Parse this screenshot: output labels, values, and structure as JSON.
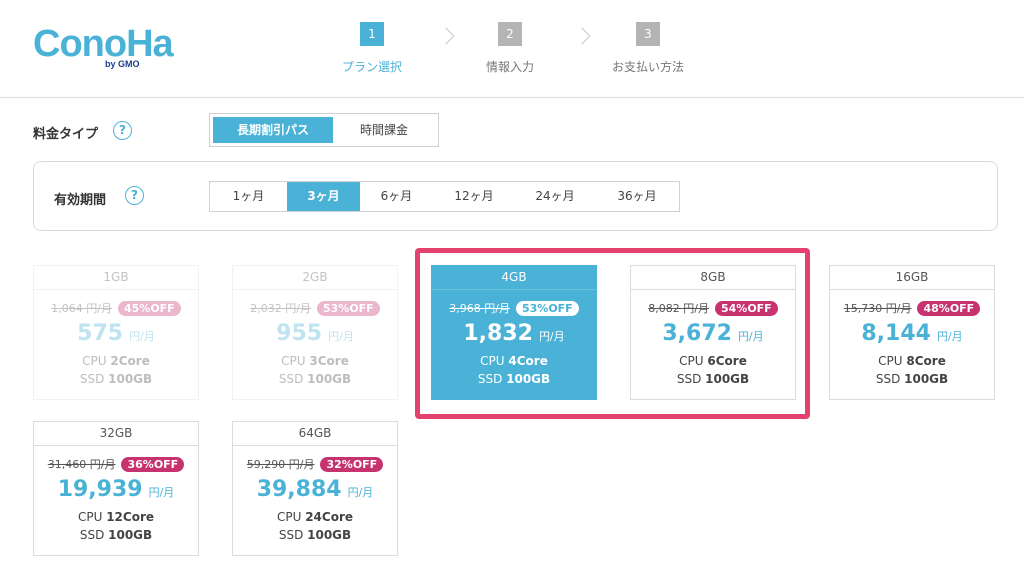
{
  "logo": {
    "text": "ConoHa",
    "by": "by GMO"
  },
  "steps": [
    {
      "num": "1",
      "label": "プラン選択"
    },
    {
      "num": "2",
      "label": "情報入力"
    },
    {
      "num": "3",
      "label": "お支払い方法"
    }
  ],
  "pricing_type": {
    "label": "料金タイプ",
    "options": [
      "長期割引パス",
      "時間課金"
    ],
    "selected": "長期割引パス"
  },
  "period": {
    "label": "有効期間",
    "options": [
      "1ヶ月",
      "3ヶ月",
      "6ヶ月",
      "12ヶ月",
      "24ヶ月",
      "36ヶ月"
    ],
    "selected": "3ヶ月"
  },
  "help_glyph": "?",
  "plans": [
    {
      "name": "1GB",
      "original": "1,064 円/月",
      "discount": "45%OFF",
      "price": "575",
      "unit": "円/月",
      "cpu_label": "CPU ",
      "cpu": "2Core",
      "ssd_label": "SSD ",
      "ssd": "100GB",
      "state": "disabled"
    },
    {
      "name": "2GB",
      "original": "2,032 円/月",
      "discount": "53%OFF",
      "price": "955",
      "unit": "円/月",
      "cpu_label": "CPU ",
      "cpu": "3Core",
      "ssd_label": "SSD ",
      "ssd": "100GB",
      "state": "disabled"
    },
    {
      "name": "4GB",
      "original": "3,968 円/月",
      "discount": "53%OFF",
      "price": "1,832",
      "unit": "円/月",
      "cpu_label": "CPU ",
      "cpu": "4Core",
      "ssd_label": "SSD ",
      "ssd": "100GB",
      "state": "selected"
    },
    {
      "name": "8GB",
      "original": "8,082 円/月",
      "discount": "54%OFF",
      "price": "3,672",
      "unit": "円/月",
      "cpu_label": "CPU ",
      "cpu": "6Core",
      "ssd_label": "SSD ",
      "ssd": "100GB",
      "state": "normal"
    },
    {
      "name": "16GB",
      "original": "15,730 円/月",
      "discount": "48%OFF",
      "price": "8,144",
      "unit": "円/月",
      "cpu_label": "CPU ",
      "cpu": "8Core",
      "ssd_label": "SSD ",
      "ssd": "100GB",
      "state": "normal"
    },
    {
      "name": "32GB",
      "original": "31,460 円/月",
      "discount": "36%OFF",
      "price": "19,939",
      "unit": "円/月",
      "cpu_label": "CPU ",
      "cpu": "12Core",
      "ssd_label": "SSD ",
      "ssd": "100GB",
      "state": "normal"
    },
    {
      "name": "64GB",
      "original": "59,290 円/月",
      "discount": "32%OFF",
      "price": "39,884",
      "unit": "円/月",
      "cpu_label": "CPU ",
      "cpu": "24Core",
      "ssd_label": "SSD ",
      "ssd": "100GB",
      "state": "normal"
    }
  ],
  "colors": {
    "accent": "#4ab2d6",
    "discount_badge": "#c6336f",
    "highlight_frame": "#e5416e"
  },
  "icons": {
    "step_separator": "chevron-right-icon",
    "help": "question-circle-icon"
  }
}
